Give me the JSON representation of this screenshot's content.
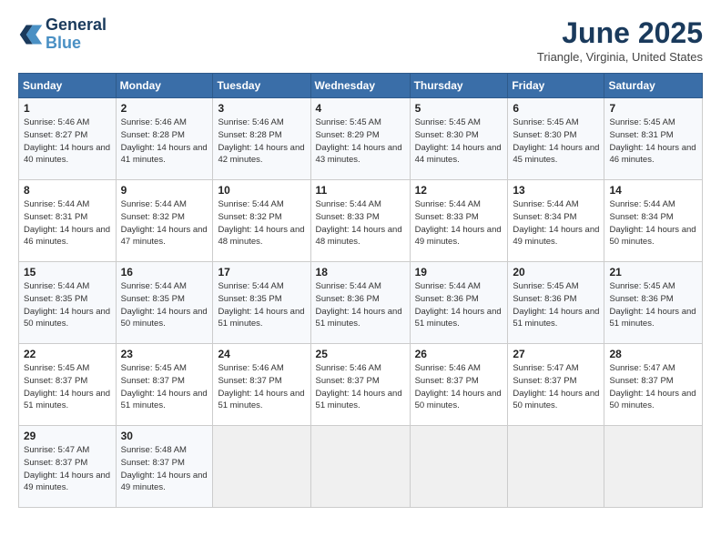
{
  "header": {
    "logo_line1": "General",
    "logo_line2": "Blue",
    "month": "June 2025",
    "location": "Triangle, Virginia, United States"
  },
  "weekdays": [
    "Sunday",
    "Monday",
    "Tuesday",
    "Wednesday",
    "Thursday",
    "Friday",
    "Saturday"
  ],
  "weeks": [
    [
      {
        "day": "1",
        "sunrise": "5:46 AM",
        "sunset": "8:27 PM",
        "daylight": "14 hours and 40 minutes."
      },
      {
        "day": "2",
        "sunrise": "5:46 AM",
        "sunset": "8:28 PM",
        "daylight": "14 hours and 41 minutes."
      },
      {
        "day": "3",
        "sunrise": "5:46 AM",
        "sunset": "8:28 PM",
        "daylight": "14 hours and 42 minutes."
      },
      {
        "day": "4",
        "sunrise": "5:45 AM",
        "sunset": "8:29 PM",
        "daylight": "14 hours and 43 minutes."
      },
      {
        "day": "5",
        "sunrise": "5:45 AM",
        "sunset": "8:30 PM",
        "daylight": "14 hours and 44 minutes."
      },
      {
        "day": "6",
        "sunrise": "5:45 AM",
        "sunset": "8:30 PM",
        "daylight": "14 hours and 45 minutes."
      },
      {
        "day": "7",
        "sunrise": "5:45 AM",
        "sunset": "8:31 PM",
        "daylight": "14 hours and 46 minutes."
      }
    ],
    [
      {
        "day": "8",
        "sunrise": "5:44 AM",
        "sunset": "8:31 PM",
        "daylight": "14 hours and 46 minutes."
      },
      {
        "day": "9",
        "sunrise": "5:44 AM",
        "sunset": "8:32 PM",
        "daylight": "14 hours and 47 minutes."
      },
      {
        "day": "10",
        "sunrise": "5:44 AM",
        "sunset": "8:32 PM",
        "daylight": "14 hours and 48 minutes."
      },
      {
        "day": "11",
        "sunrise": "5:44 AM",
        "sunset": "8:33 PM",
        "daylight": "14 hours and 48 minutes."
      },
      {
        "day": "12",
        "sunrise": "5:44 AM",
        "sunset": "8:33 PM",
        "daylight": "14 hours and 49 minutes."
      },
      {
        "day": "13",
        "sunrise": "5:44 AM",
        "sunset": "8:34 PM",
        "daylight": "14 hours and 49 minutes."
      },
      {
        "day": "14",
        "sunrise": "5:44 AM",
        "sunset": "8:34 PM",
        "daylight": "14 hours and 50 minutes."
      }
    ],
    [
      {
        "day": "15",
        "sunrise": "5:44 AM",
        "sunset": "8:35 PM",
        "daylight": "14 hours and 50 minutes."
      },
      {
        "day": "16",
        "sunrise": "5:44 AM",
        "sunset": "8:35 PM",
        "daylight": "14 hours and 50 minutes."
      },
      {
        "day": "17",
        "sunrise": "5:44 AM",
        "sunset": "8:35 PM",
        "daylight": "14 hours and 51 minutes."
      },
      {
        "day": "18",
        "sunrise": "5:44 AM",
        "sunset": "8:36 PM",
        "daylight": "14 hours and 51 minutes."
      },
      {
        "day": "19",
        "sunrise": "5:44 AM",
        "sunset": "8:36 PM",
        "daylight": "14 hours and 51 minutes."
      },
      {
        "day": "20",
        "sunrise": "5:45 AM",
        "sunset": "8:36 PM",
        "daylight": "14 hours and 51 minutes."
      },
      {
        "day": "21",
        "sunrise": "5:45 AM",
        "sunset": "8:36 PM",
        "daylight": "14 hours and 51 minutes."
      }
    ],
    [
      {
        "day": "22",
        "sunrise": "5:45 AM",
        "sunset": "8:37 PM",
        "daylight": "14 hours and 51 minutes."
      },
      {
        "day": "23",
        "sunrise": "5:45 AM",
        "sunset": "8:37 PM",
        "daylight": "14 hours and 51 minutes."
      },
      {
        "day": "24",
        "sunrise": "5:46 AM",
        "sunset": "8:37 PM",
        "daylight": "14 hours and 51 minutes."
      },
      {
        "day": "25",
        "sunrise": "5:46 AM",
        "sunset": "8:37 PM",
        "daylight": "14 hours and 51 minutes."
      },
      {
        "day": "26",
        "sunrise": "5:46 AM",
        "sunset": "8:37 PM",
        "daylight": "14 hours and 50 minutes."
      },
      {
        "day": "27",
        "sunrise": "5:47 AM",
        "sunset": "8:37 PM",
        "daylight": "14 hours and 50 minutes."
      },
      {
        "day": "28",
        "sunrise": "5:47 AM",
        "sunset": "8:37 PM",
        "daylight": "14 hours and 50 minutes."
      }
    ],
    [
      {
        "day": "29",
        "sunrise": "5:47 AM",
        "sunset": "8:37 PM",
        "daylight": "14 hours and 49 minutes."
      },
      {
        "day": "30",
        "sunrise": "5:48 AM",
        "sunset": "8:37 PM",
        "daylight": "14 hours and 49 minutes."
      },
      null,
      null,
      null,
      null,
      null
    ]
  ]
}
